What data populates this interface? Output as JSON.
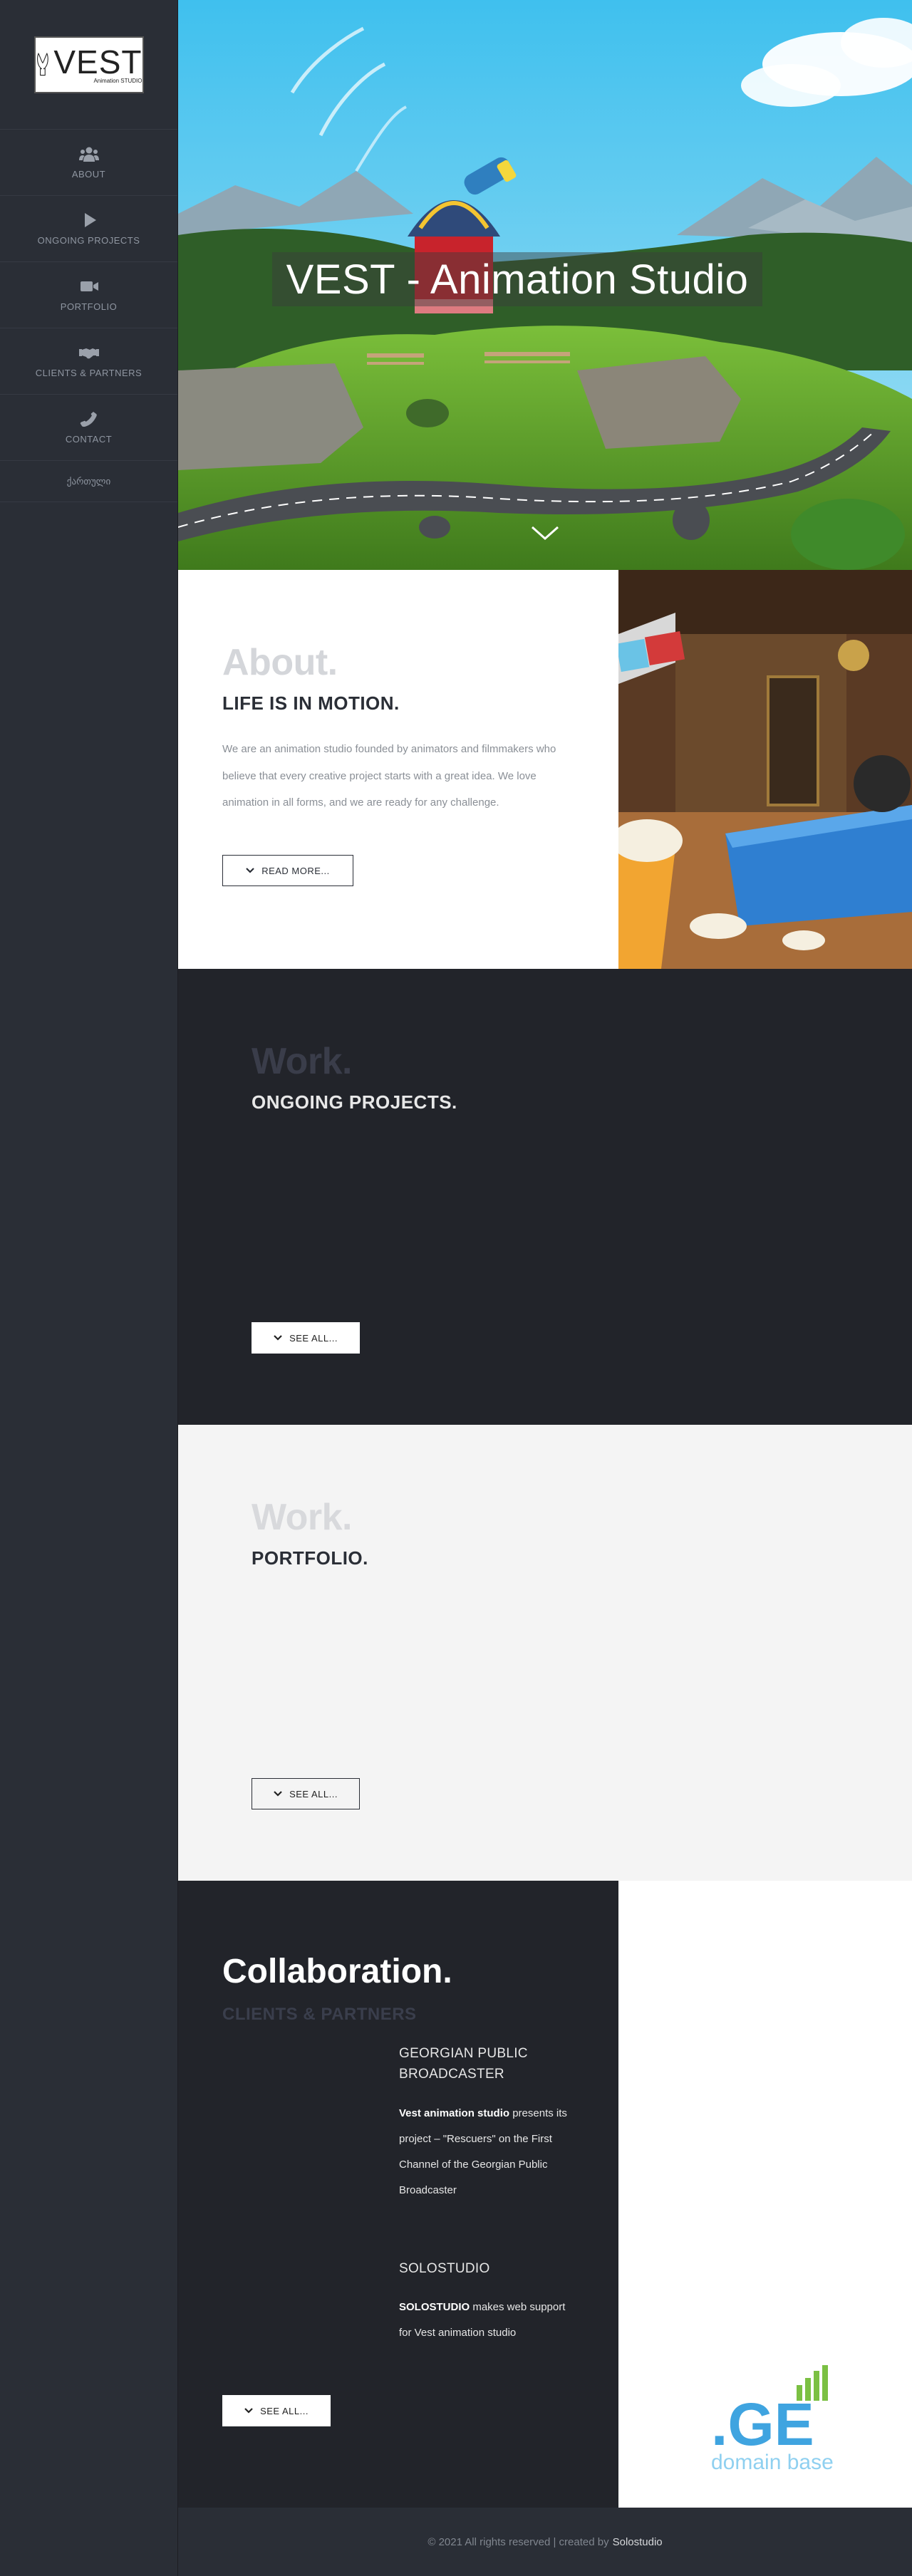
{
  "sidebar": {
    "logo": {
      "big": "VEST",
      "small": "Animation STUDIO"
    },
    "items": [
      {
        "label": "ABOUT",
        "icon": "users-icon"
      },
      {
        "label": "ONGOING PROJECTS",
        "icon": "play-icon"
      },
      {
        "label": "PORTFOLIO",
        "icon": "video-camera-icon"
      },
      {
        "label": "CLIENTS & PARTNERS",
        "icon": "handshake-icon"
      },
      {
        "label": "CONTACT",
        "icon": "phone-icon"
      }
    ],
    "language": "ქართული"
  },
  "hero": {
    "title": "VEST - Animation Studio",
    "scroll_icon": "chevron-down-icon"
  },
  "about": {
    "title": "About.",
    "subtitle": "LIFE IS IN MOTION.",
    "text": "We are an animation studio founded by animators and filmmakers who believe that every creative project starts with a great idea. We love animation in all forms, and we are ready for any challenge.",
    "button": "READ MORE..."
  },
  "ongoing": {
    "title": "Work.",
    "subtitle": "ONGOING PROJECTS.",
    "button": "SEE ALL..."
  },
  "portfolio": {
    "title": "Work.",
    "subtitle": "PORTFOLIO.",
    "button": "SEE ALL..."
  },
  "collaboration": {
    "title": "Collaboration.",
    "subtitle": "CLIENTS & PARTNERS",
    "partners": [
      {
        "name": "GEORGIAN PUBLIC BROADCASTER",
        "bold": "Vest animation studio",
        "desc": " presents its project – \"Rescuers\" on the First Channel of the Georgian Public Broadcaster"
      },
      {
        "name": "SOLOSTUDIO",
        "bold": "SOLOSTUDIO",
        "desc": " makes web support for Vest animation studio"
      }
    ],
    "button": "SEE ALL...",
    "sponsor_logo": {
      "main": ".GE",
      "caption": "domain base"
    }
  },
  "footer": {
    "text": "© 2021 All rights reserved | created by",
    "link": "Solostudio"
  },
  "colors": {
    "sidebar_bg": "#2a2e36",
    "dark_section_bg": "#22242a",
    "light_section_bg": "#f4f4f4",
    "sky": "#4fc3ea",
    "grass": "#5a9a2a",
    "ge_blue": "#3fa4e0",
    "ge_green": "#7bc043"
  }
}
